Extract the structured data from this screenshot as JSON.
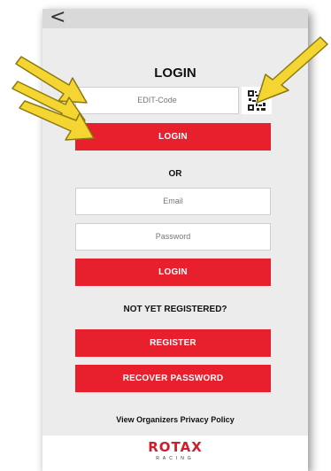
{
  "nav": {
    "back_glyph": "<"
  },
  "login": {
    "title": "LOGIN",
    "edit_code_placeholder": "EDIT-Code",
    "login_button_1": "LOGIN",
    "or_label": "OR",
    "email_placeholder": "Email",
    "password_placeholder": "Password",
    "login_button_2": "LOGIN"
  },
  "register": {
    "prompt": "NOT YET REGISTERED?",
    "register_button": "REGISTER",
    "recover_button": "RECOVER PASSWORD",
    "privacy_link": "View Organizers Privacy Policy"
  },
  "footer": {
    "logo_text": "ROTAX",
    "logo_subtext": "RACING"
  },
  "icons": {
    "qr": "qr-code-icon",
    "back": "back-chevron-icon",
    "arrows": "callout-arrow-icon"
  },
  "colors": {
    "accent": "#e8202e",
    "arrow_fill": "#f5d531"
  }
}
